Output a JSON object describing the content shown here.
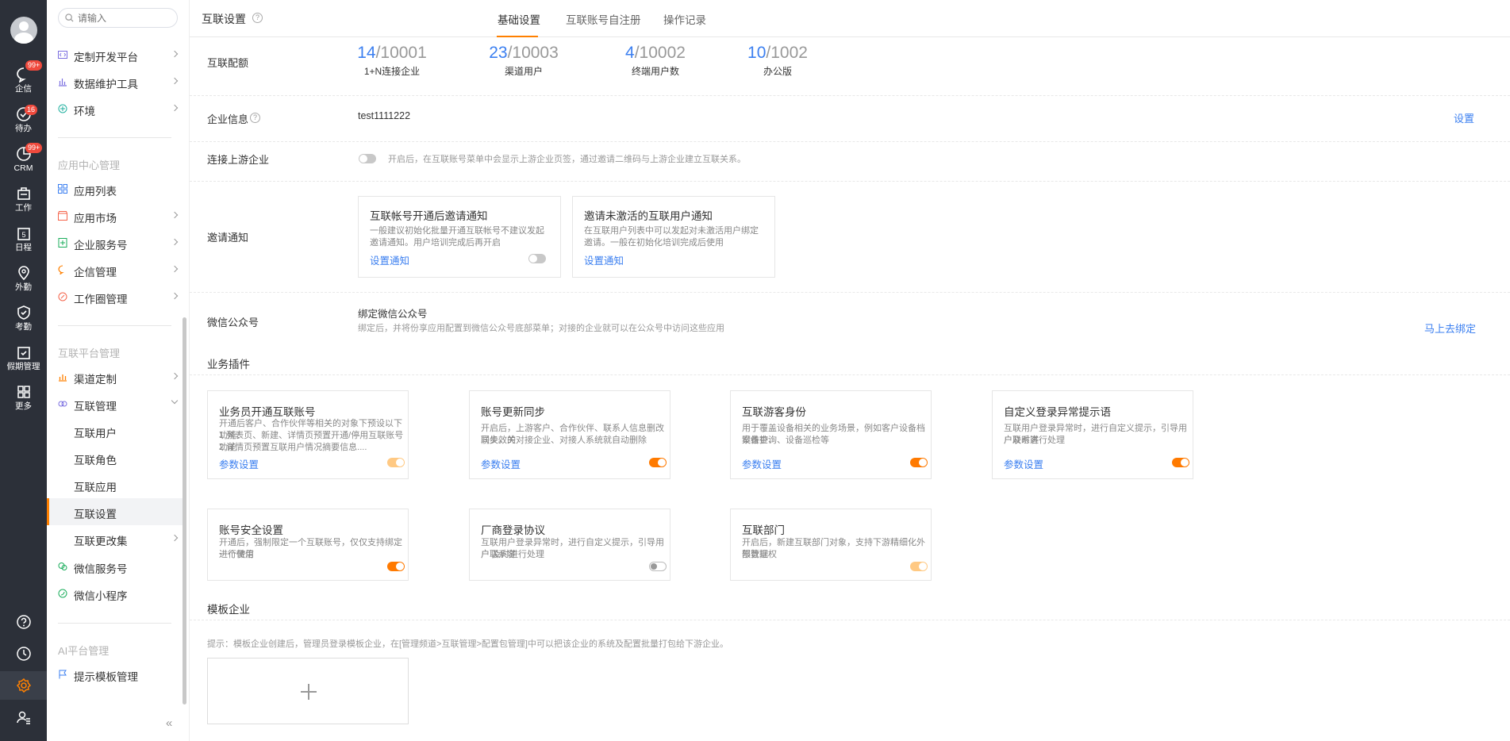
{
  "rail": {
    "items": [
      {
        "label": "企信",
        "badge": "99+"
      },
      {
        "label": "待办",
        "badge": "16"
      },
      {
        "label": "CRM",
        "badge": "99+"
      },
      {
        "label": "工作",
        "badge": ""
      },
      {
        "label": "日程",
        "badge": ""
      },
      {
        "label": "外勤",
        "badge": ""
      },
      {
        "label": "考勤",
        "badge": ""
      },
      {
        "label": "假期管理",
        "badge": ""
      },
      {
        "label": "更多",
        "badge": ""
      }
    ],
    "bottom_icons": [
      "help-icon",
      "clock-icon",
      "settings-icon",
      "user-settings-icon"
    ]
  },
  "subnav": {
    "search_placeholder": "请输入",
    "items_top": [
      {
        "label": "定制开发平台",
        "icon": "code-icon",
        "color": "#7b6fe0"
      },
      {
        "label": "数据维护工具",
        "icon": "bar-chart-icon",
        "color": "#7b6fe0"
      },
      {
        "label": "环境",
        "icon": "environment-icon",
        "color": "#22b1a0"
      }
    ],
    "group_app": "应用中心管理",
    "items_app": [
      {
        "label": "应用列表",
        "icon": "grid-icon",
        "color": "#3b7ff0"
      },
      {
        "label": "应用市场",
        "icon": "market-icon",
        "color": "#f5634a"
      },
      {
        "label": "企业服务号",
        "icon": "service-icon",
        "color": "#1aad5b"
      },
      {
        "label": "企信管理",
        "icon": "chat-icon",
        "color": "#ff8000"
      },
      {
        "label": "工作圈管理",
        "icon": "circle-icon",
        "color": "#f5634a"
      }
    ],
    "group_interconnect": "互联平台管理",
    "items_interconnect": [
      {
        "label": "渠道定制",
        "icon": "channel-icon",
        "color": "#ff8000"
      },
      {
        "label": "互联管理",
        "icon": "link-icon",
        "color": "#7b6fe0"
      }
    ],
    "sub_items": [
      "互联用户",
      "互联角色",
      "互联应用",
      "互联设置"
    ],
    "items_after": [
      {
        "label": "互联更改集"
      },
      {
        "label": "微信服务号",
        "icon": "wechat-icon",
        "color": "#1aad5b"
      },
      {
        "label": "微信小程序",
        "icon": "miniprogram-icon",
        "color": "#1aad5b"
      }
    ],
    "group_ai": "AI平台管理",
    "items_ai": [
      {
        "label": "提示模板管理",
        "icon": "flag-icon",
        "color": "#3b7ff0"
      }
    ]
  },
  "topbar": {
    "title": "互联设置",
    "tabs": [
      "基础设置",
      "互联账号自注册",
      "操作记录"
    ]
  },
  "quota": {
    "label": "互联配额",
    "items": [
      {
        "used": "14",
        "total": "/10001",
        "label": "1+N连接企业"
      },
      {
        "used": "23",
        "total": "/10003",
        "label": "渠道用户"
      },
      {
        "used": "4",
        "total": "/10002",
        "label": "终端用户数"
      },
      {
        "used": "10",
        "total": "/1002",
        "label": "办公版"
      }
    ]
  },
  "company": {
    "label": "企业信息",
    "value": "test1111222",
    "action": "设置"
  },
  "upstream": {
    "label": "连接上游企业",
    "desc": "开启后，在互联账号菜单中会显示上游企业页签，通过邀请二维码与上游企业建立互联关系。",
    "enabled": false
  },
  "invite": {
    "label": "邀请通知",
    "cards": [
      {
        "title": "互联帐号开通后邀请通知",
        "desc1": "一般建议初始化批量开通互联帐号不建议发起",
        "desc2": "邀请通知。用户培训完成后再开启",
        "link": "设置通知",
        "enabled": false
      },
      {
        "title": "邀请未激活的互联用户通知",
        "desc1": "在互联用户列表中可以发起对未激活用户绑定",
        "desc2": "邀请。一般在初始化培训完成后使用",
        "link": "设置通知"
      }
    ]
  },
  "wechat": {
    "label": "微信公众号",
    "title": "绑定微信公众号",
    "desc": "绑定后，并将份享应用配置到微信公众号底部菜单；对接的企业就可以在公众号中访问这些应用",
    "action": "马上去绑定"
  },
  "plugins": {
    "title": "业务插件",
    "row1": [
      {
        "title": "业务员开通互联账号",
        "desc": [
          "开通后客户、合作伙伴等相关的对象下预设以下功能：",
          "1.列表页、新建、详情页预置开通/停用互联账号功能",
          "2.详情页预置互联用户情况摘要信息...."
        ],
        "link": "参数设置",
        "state": "on-dis"
      },
      {
        "title": "账号更新同步",
        "desc": [
          "开启后，上游客户、合作伙伴、联系人信息删改同步。关",
          "联失效的对接企业、对接人系统就自动删除"
        ],
        "link": "参数设置",
        "state": "on"
      },
      {
        "title": "互联游客身份",
        "desc": [
          "用于覆盖设备相关的业务场景，例如客户设备档案维护、",
          "设备查询、设备巡检等"
        ],
        "link": "参数设置",
        "state": "on"
      },
      {
        "title": "自定义登录异常提示语",
        "desc": [
          "互联用户登录异常时，进行自定义提示，引导用户联系客",
          "户及时进行处理"
        ],
        "link": "参数设置",
        "state": "on"
      }
    ],
    "row2": [
      {
        "title": "账号安全设置",
        "desc": [
          "开通后，强制限定一个互联账号，仅仅支持绑定一个微信",
          "进行使用"
        ],
        "link": "",
        "state": "on"
      },
      {
        "title": "厂商登录协议",
        "desc": [
          "互联用户登录异常时，进行自定义提示，引导用户联系客",
          "户 及时进行处理"
        ],
        "link": "",
        "state": "off-outline"
      },
      {
        "title": "互联部门",
        "desc": [
          "开启后，新建互联部门对象，支持下游精细化外部数据权",
          "限管理"
        ],
        "link": "",
        "state": "on-dis"
      }
    ]
  },
  "template": {
    "title": "模板企业",
    "hint": "提示：模板企业创建后，管理员登录模板企业，在[管理频道>互联管理>配置包管理]中可以把该企业的系统及配置批量打包给下游企业。"
  },
  "colors": {
    "accent": "#ff8000",
    "link": "#3b7ff0",
    "rail_bg": "#2c3039"
  }
}
